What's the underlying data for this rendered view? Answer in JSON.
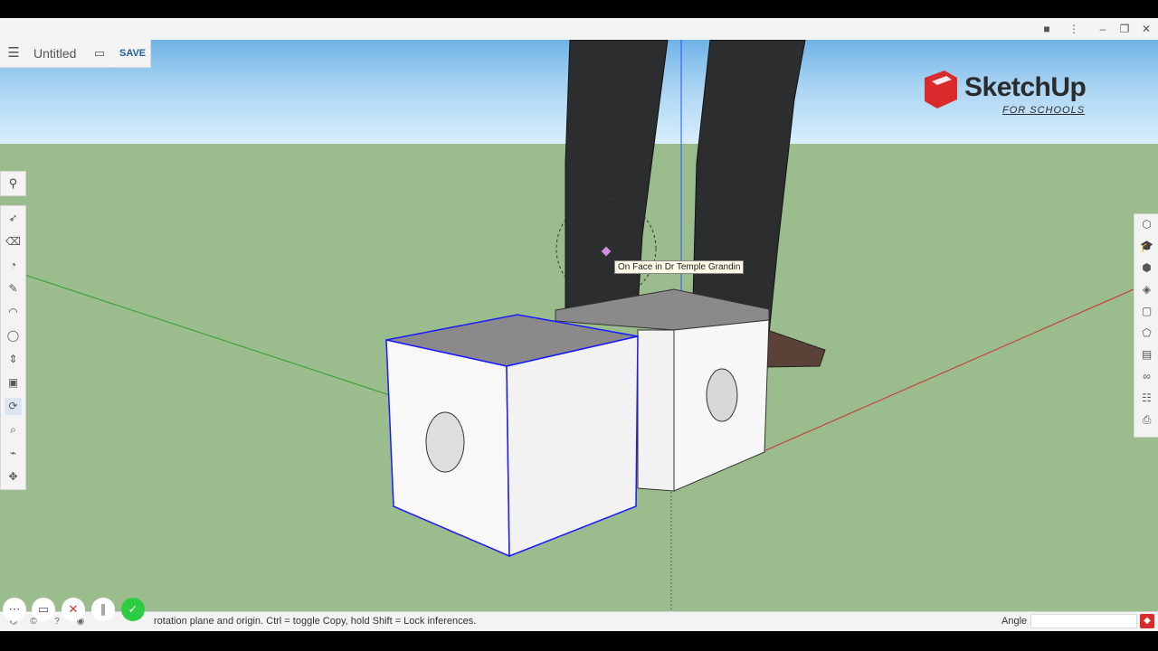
{
  "file": {
    "title": "Untitled",
    "save_label": "SAVE"
  },
  "logo": {
    "name": "SketchUp",
    "sub": "FOR SCHOOLS"
  },
  "viewport": {
    "tooltip": "On Face in Dr Temple Grandin"
  },
  "status": {
    "hint": "rotation plane and origin. Ctrl = toggle Copy, hold Shift = Lock inferences.",
    "angle_label": "Angle",
    "angle_value": ""
  },
  "icons": {
    "menu": "menu-icon",
    "folder": "folder-icon",
    "search": "search-icon",
    "left_tools": [
      "select",
      "eraser",
      "paint-bucket",
      "pencil",
      "arc",
      "circle",
      "push-pull",
      "offset",
      "rotate",
      "tape-measure",
      "orbit",
      "move"
    ],
    "right_tools": [
      "entity-info",
      "instructor",
      "components",
      "materials",
      "styles",
      "tags",
      "scenes",
      "display",
      "outliner",
      "export"
    ]
  },
  "colors": {
    "edge_selected": "#1a1aff",
    "ground": "#9bbc8c",
    "sky": "#a9d4f3",
    "accent": "#1f5f9a",
    "record_stop": "#d92b2b",
    "record_ok": "#2ecc40"
  }
}
